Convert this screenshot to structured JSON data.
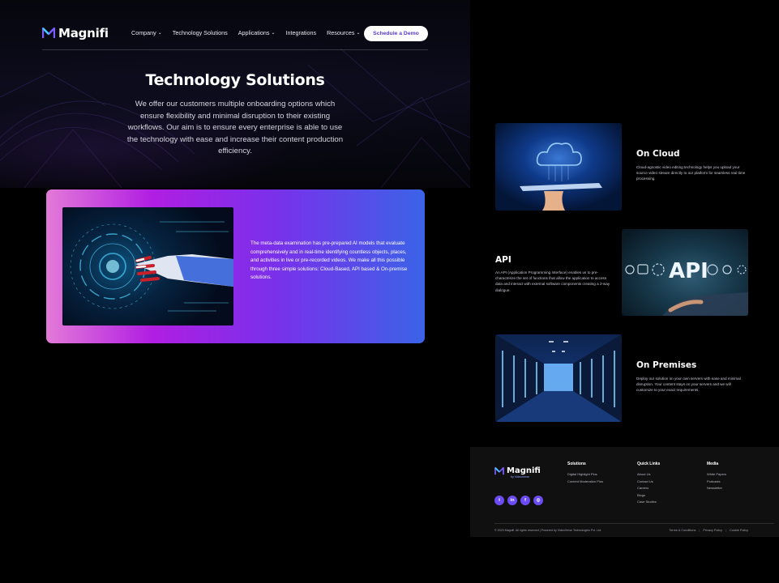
{
  "brand": {
    "name": "Magnifi",
    "accent": "#6a4cf2"
  },
  "nav": {
    "items": [
      {
        "label": "Company",
        "has_dropdown": true
      },
      {
        "label": "Technology Solutions",
        "has_dropdown": false
      },
      {
        "label": "Applications",
        "has_dropdown": true
      },
      {
        "label": "Integrations",
        "has_dropdown": false
      },
      {
        "label": "Resources",
        "has_dropdown": true
      }
    ],
    "cta_label": "Schedule a Demo"
  },
  "hero": {
    "title": "Technology Solutions",
    "text": "We offer our customers multiple onboarding options which ensure flexibility and minimal disruption to their existing workflows. Our aim is to ensure every enterprise is able to use the technology with ease and increase their content production efficiency."
  },
  "intro_card": {
    "text": "The meta-data examination has pre-prepared AI models that evaluate comprehensively and in real-time identifying countless objects, places, and activities in live or pre-recorded videos. We make all this possible through three simple solutions: Cloud-Based, API based & On-premise solutions.",
    "colors": {
      "start": "#e37ad8",
      "mid": "#b01ee2",
      "end": "#3b63e8"
    }
  },
  "features": [
    {
      "title": "On Cloud",
      "desc": "Cloud-agnostic video editing technology helps you upload your source video stream directly to our platform for seamless real time processing.",
      "image": "cloud-on-tablet"
    },
    {
      "title": "API",
      "desc": "An API (Application Programming Interface) enables us to pre-characterize the set of functions that allow the application to access data and interact with external software components creating a 2-way dialogue.",
      "image": "api-hand-interface"
    },
    {
      "title": "On Premises",
      "desc": "Deploy our solution on your own servers with ease and minimal disruption. Your content stays on your servers and we will customize to your exact requirements.",
      "image": "server-room"
    }
  ],
  "footer": {
    "brand": "Magnifi",
    "tagline": "by VideoVerse",
    "socials": [
      {
        "icon": "twitter-icon",
        "glyph": "t"
      },
      {
        "icon": "linkedin-icon",
        "glyph": "in"
      },
      {
        "icon": "facebook-icon",
        "glyph": "f"
      },
      {
        "icon": "instagram-icon",
        "glyph": "◎"
      }
    ],
    "columns": [
      {
        "title": "Solutions",
        "items": [
          "Digital Highlight Plus",
          "Content Moderation Plus"
        ]
      },
      {
        "title": "Quick Links",
        "items": [
          "About Us",
          "Contact Us",
          "Careers",
          "Blogs",
          "Case Studies"
        ]
      },
      {
        "title": "Media",
        "items": [
          "White Papers",
          "Podcasts",
          "Newsletter"
        ]
      }
    ],
    "copyright": "© 2023 Magnifi. All rights reserved | Powered by VideoVerse Technologies Pvt. Ltd.",
    "legal": [
      "Terms & Conditions",
      "Privacy Policy",
      "Cookie Policy"
    ]
  }
}
